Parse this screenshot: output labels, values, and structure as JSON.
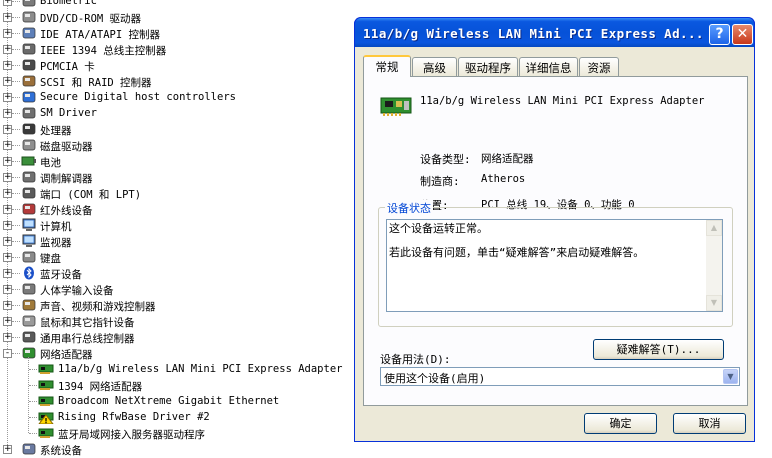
{
  "tree": {
    "items": [
      {
        "label": "Biometric",
        "icon": "biometric-icon",
        "expander": "+"
      },
      {
        "label": "DVD/CD-ROM 驱动器",
        "icon": "cdrom-icon",
        "expander": "+"
      },
      {
        "label": "IDE ATA/ATAPI 控制器",
        "icon": "ide-controller-icon",
        "expander": "+"
      },
      {
        "label": "IEEE 1394 总线主控制器",
        "icon": "ieee1394-icon",
        "expander": "+"
      },
      {
        "label": "PCMCIA 卡",
        "icon": "pcmcia-icon",
        "expander": "+"
      },
      {
        "label": "SCSI 和 RAID 控制器",
        "icon": "scsi-icon",
        "expander": "+"
      },
      {
        "label": "Secure Digital host controllers",
        "icon": "sd-host-icon",
        "expander": "+"
      },
      {
        "label": "SM Driver",
        "icon": "sm-driver-icon",
        "expander": "+"
      },
      {
        "label": "处理器",
        "icon": "processor-icon",
        "expander": "+"
      },
      {
        "label": "磁盘驱动器",
        "icon": "disk-drive-icon",
        "expander": "+"
      },
      {
        "label": "电池",
        "icon": "battery-icon",
        "expander": "+"
      },
      {
        "label": "调制解调器",
        "icon": "modem-icon",
        "expander": "+"
      },
      {
        "label": "端口 (COM 和 LPT)",
        "icon": "port-icon",
        "expander": "+"
      },
      {
        "label": "红外线设备",
        "icon": "infrared-icon",
        "expander": "+"
      },
      {
        "label": "计算机",
        "icon": "computer-icon",
        "expander": "+"
      },
      {
        "label": "监视器",
        "icon": "monitor-icon",
        "expander": "+"
      },
      {
        "label": "键盘",
        "icon": "keyboard-icon",
        "expander": "+"
      },
      {
        "label": "蓝牙设备",
        "icon": "bluetooth-icon",
        "expander": "+"
      },
      {
        "label": "人体学输入设备",
        "icon": "hid-icon",
        "expander": "+"
      },
      {
        "label": "声音、视频和游戏控制器",
        "icon": "sound-icon",
        "expander": "+"
      },
      {
        "label": "鼠标和其它指针设备",
        "icon": "mouse-icon",
        "expander": "+"
      },
      {
        "label": "通用串行总线控制器",
        "icon": "usb-icon",
        "expander": "+"
      },
      {
        "label": "网络适配器",
        "icon": "network-adapter-icon",
        "expander": "-"
      }
    ],
    "children": [
      {
        "label": "11a/b/g Wireless LAN Mini PCI Express Adapter",
        "icon": "nic-icon"
      },
      {
        "label": "1394 网络适配器",
        "icon": "nic-icon"
      },
      {
        "label": "Broadcom NetXtreme Gigabit Ethernet",
        "icon": "nic-icon"
      },
      {
        "label": "Rising RfwBase Driver #2",
        "icon": "nic-warning-icon"
      },
      {
        "label": "蓝牙局域网接入服务器驱动程序",
        "icon": "nic-icon"
      }
    ],
    "last_item": {
      "label": "系统设备",
      "icon": "system-device-icon",
      "expander": "+"
    }
  },
  "dialog": {
    "title": "11a/b/g Wireless LAN Mini PCI Express Ad...",
    "help_label": "?",
    "close_label": "✕",
    "tabs": [
      "常规",
      "高级",
      "驱动程序",
      "详细信息",
      "资源"
    ],
    "active_tab": "常规",
    "device_name": "11a/b/g Wireless LAN Mini PCI Express Adapter",
    "props": {
      "type_label": "设备类型:",
      "type_value": "网络适配器",
      "maker_label": "制造商:",
      "maker_value": "Atheros",
      "location_label": "位置:",
      "location_value": "PCI 总线 19、设备 0、功能 0"
    },
    "status": {
      "legend": "设备状态",
      "line1": "这个设备运转正常。",
      "line2": "若此设备有问题，单击“疑难解答”来启动疑难解答。"
    },
    "troubleshoot_label": "疑难解答(T)...",
    "usage_label": "设备用法(D):",
    "usage_value": "使用这个设备(启用)",
    "ok_label": "确定",
    "cancel_label": "取消",
    "colors": {
      "title_bar": "#0652d8",
      "dialog_bg": "#ece9d8",
      "legend_text": "#0046d5"
    }
  }
}
